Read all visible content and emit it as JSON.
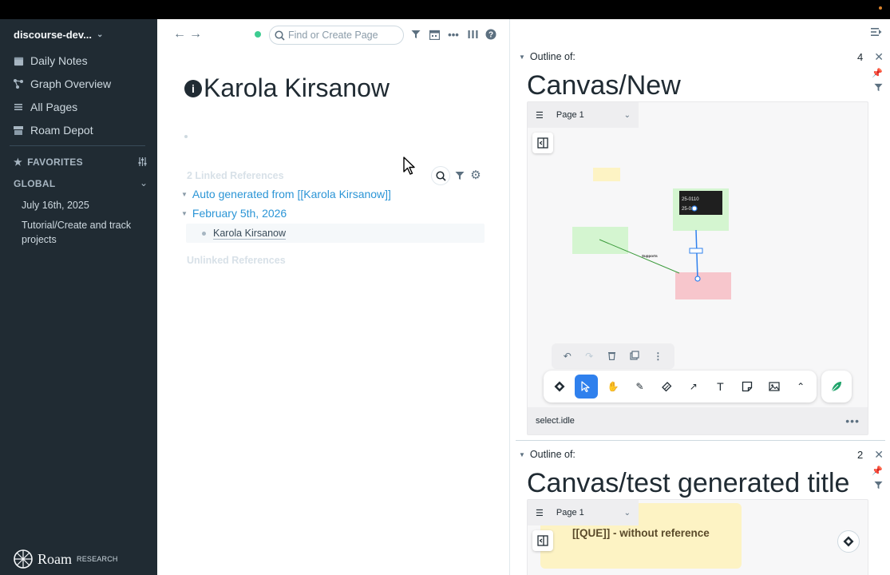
{
  "sidebar": {
    "graph_name": "discourse-dev...",
    "nav": [
      {
        "label": "Daily Notes",
        "icon": "calendar-icon"
      },
      {
        "label": "Graph Overview",
        "icon": "graph-icon"
      },
      {
        "label": "All Pages",
        "icon": "list-icon"
      },
      {
        "label": "Roam Depot",
        "icon": "store-icon"
      }
    ],
    "favorites_label": "FAVORITES",
    "global_label": "GLOBAL",
    "shortcuts": [
      "July 16th, 2025",
      "Tutorial/Create and track projects"
    ],
    "logo_word": "Roam",
    "logo_suffix": "RESEARCH"
  },
  "main": {
    "search_placeholder": "Find or Create Page",
    "page_title": "Karola Kirsanow",
    "title_badge": "i",
    "linked_refs_label": "2 Linked References",
    "ref_groups": [
      "Auto generated from [[Karola Kirsanow]]",
      "February 5th, 2026"
    ],
    "ref_block_text": "Karola Kirsanow",
    "unlinked_refs_label": "Unlinked References"
  },
  "right": {
    "outlines": [
      {
        "label": "Outline of:",
        "count": "4",
        "title": "Canvas/New",
        "page_select": "Page 1",
        "status": "select.idle",
        "nodes": [
          {
            "text": "25-0110"
          },
          {
            "text": "25-01"
          }
        ],
        "edge_label": "Supports"
      },
      {
        "label": "Outline of:",
        "count": "2",
        "title": "Canvas/test generated title",
        "page_select": "Page 1",
        "sticky_text": "[[QUE]] - without reference"
      }
    ]
  },
  "colors": {
    "sidebar_bg": "#202b33",
    "link": "#2b95d6",
    "tool_active": "#2f80ed",
    "node_green": "#d4f5d0",
    "node_pink": "#f7c6cc",
    "node_dark": "#1f1f1f",
    "sticky": "#fdf3c4"
  }
}
